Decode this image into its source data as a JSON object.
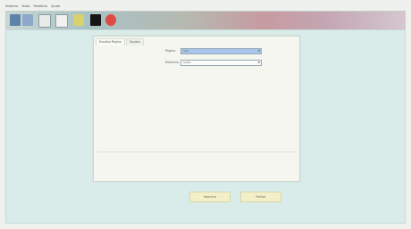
{
  "menu": [
    "Sistema",
    "Visão",
    "Relatório",
    "Ajuda"
  ],
  "toolbar_icons": [
    "user-icon",
    "chart-icon",
    "document-icon",
    "document-icon-2",
    "folder-icon",
    "screen-icon",
    "stop-icon"
  ],
  "dialog": {
    "tabs": [
      "Escolha Página",
      "Opções"
    ],
    "fields": [
      {
        "label": "Página",
        "value": "100",
        "selected": true
      },
      {
        "label": "Relatório",
        "value": "Saída",
        "selected": false
      }
    ],
    "buttons": [
      "Imprimir",
      "Fechar"
    ]
  }
}
